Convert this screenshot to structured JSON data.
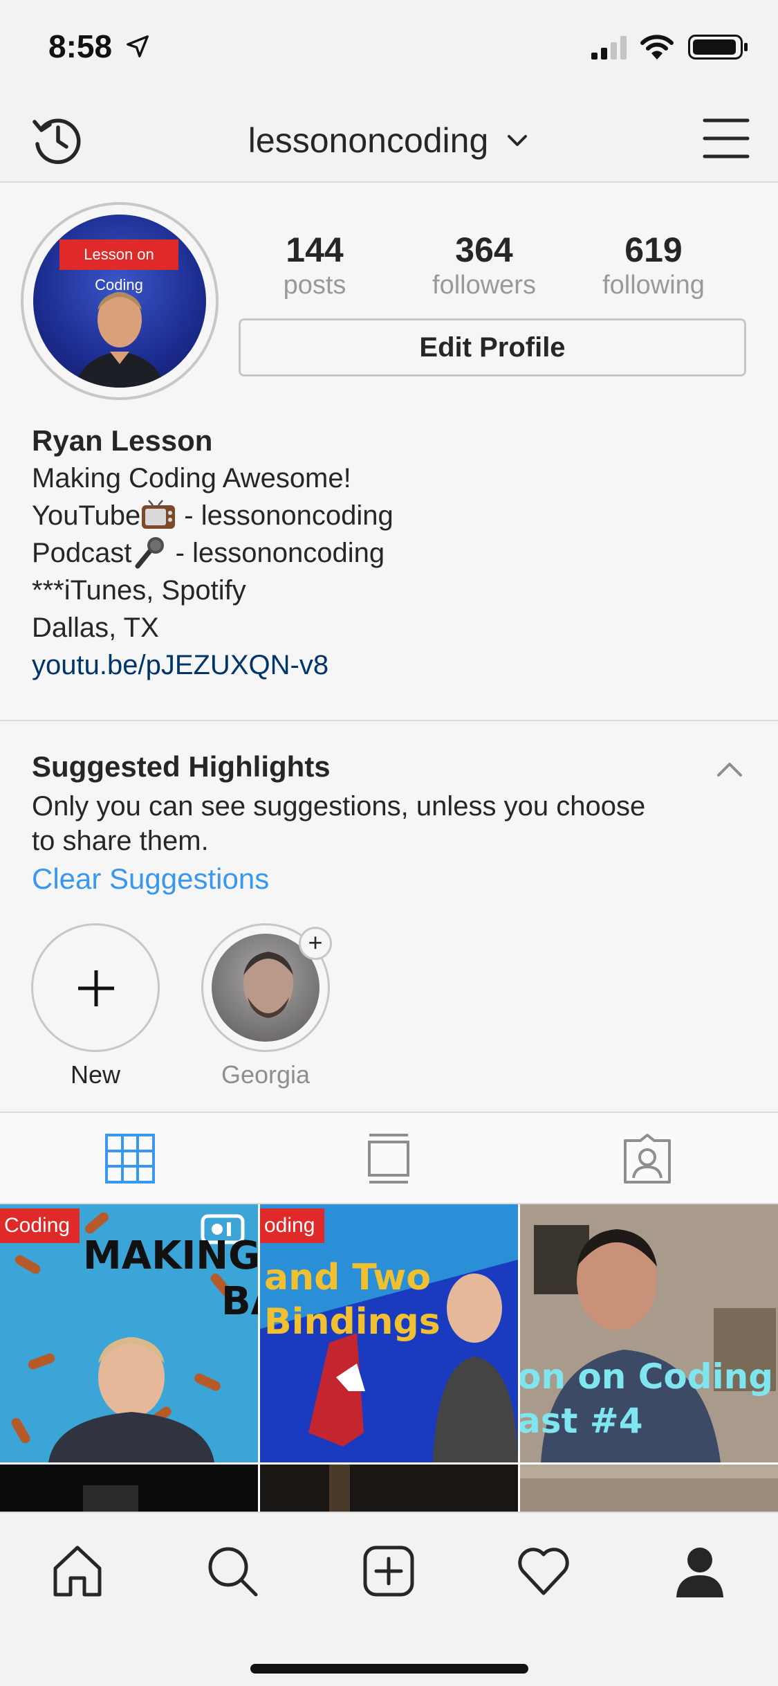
{
  "status": {
    "time": "8:58",
    "icons": [
      "location-arrow-icon",
      "signal-icon",
      "wifi-icon",
      "battery-icon"
    ]
  },
  "header": {
    "username": "lessononcoding",
    "icons": [
      "history-icon",
      "chevron-down-icon",
      "menu-icon"
    ]
  },
  "profile": {
    "avatar_tag": "Lesson on Coding",
    "stats": [
      {
        "value": "144",
        "label": "posts"
      },
      {
        "value": "364",
        "label": "followers"
      },
      {
        "value": "619",
        "label": "following"
      }
    ],
    "edit_label": "Edit Profile",
    "full_name": "Ryan Lesson",
    "bio": {
      "line1": "Making Coding Awesome!",
      "youtube_prefix": "YouTube",
      "youtube_suffix": " - lessononcoding",
      "podcast_prefix": "Podcast",
      "podcast_suffix": " - lessononcoding",
      "line4": "***iTunes, Spotify",
      "line5": "Dallas, TX",
      "link": "youtu.be/pJEZUXQN-v8"
    }
  },
  "highlights": {
    "title": "Suggested Highlights",
    "description": "Only you can see suggestions, unless you choose to share them.",
    "clear_label": "Clear Suggestions",
    "items": [
      {
        "label": "New"
      },
      {
        "label": "Georgia"
      }
    ]
  },
  "tabs": [
    "grid-icon",
    "feed-icon",
    "tagged-icon"
  ],
  "grid": {
    "tiles": [
      {
        "tag": "Coding",
        "text1": "MAKING IT",
        "text2": "BA"
      },
      {
        "tag": "oding",
        "text1": "and Two",
        "text2": "Bindings"
      },
      {
        "tag": "",
        "text1": "on on Coding",
        "text2": "ast #4"
      }
    ]
  },
  "bottom_nav": [
    "home-icon",
    "search-icon",
    "add-post-icon",
    "activity-heart-icon",
    "profile-icon"
  ],
  "colors": {
    "link": "#003569",
    "accent": "#3897f0",
    "tab_active": "#3897f0",
    "muted": "#999999"
  }
}
